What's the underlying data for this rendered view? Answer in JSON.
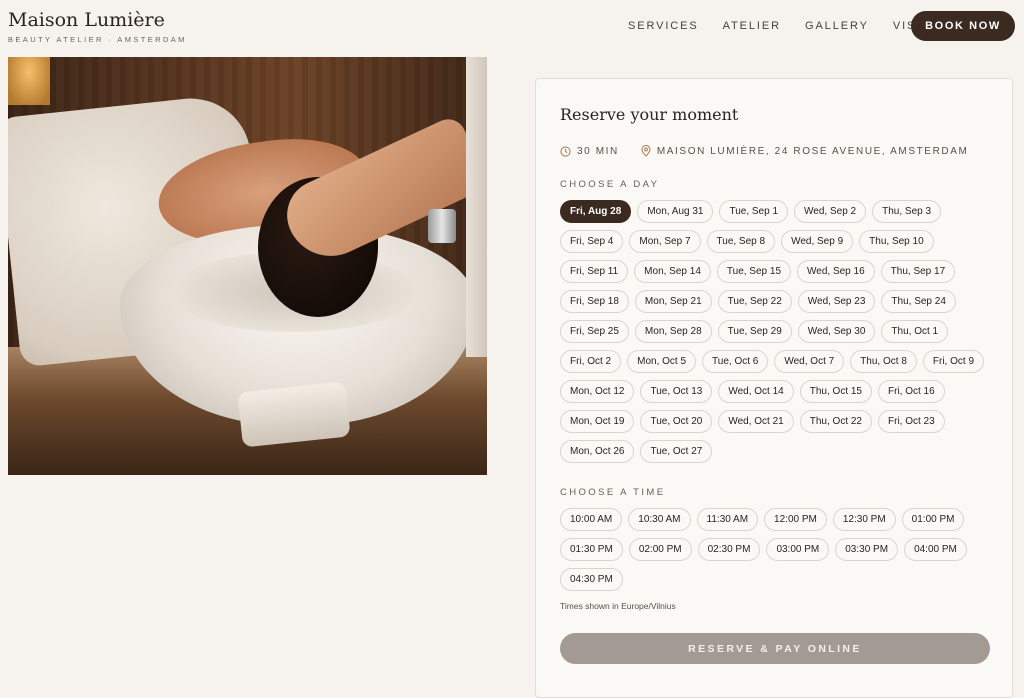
{
  "brand": {
    "name": "Maison Lumière",
    "tagline": "BEAUTY ATELIER · AMSTERDAM"
  },
  "nav": {
    "items": [
      "SERVICES",
      "ATELIER",
      "GALLERY",
      "VISIT"
    ],
    "cta": "BOOK NOW"
  },
  "booking": {
    "title": "Reserve your moment",
    "duration": "30 MIN",
    "location": "MAISON LUMIÈRE, 24 ROSE AVENUE, AMSTERDAM",
    "day_label": "CHOOSE A DAY",
    "days": [
      "Fri, Aug 28",
      "Mon, Aug 31",
      "Tue, Sep 1",
      "Wed, Sep 2",
      "Thu, Sep 3",
      "Fri, Sep 4",
      "Mon, Sep 7",
      "Tue, Sep 8",
      "Wed, Sep 9",
      "Thu, Sep 10",
      "Fri, Sep 11",
      "Mon, Sep 14",
      "Tue, Sep 15",
      "Wed, Sep 16",
      "Thu, Sep 17",
      "Fri, Sep 18",
      "Mon, Sep 21",
      "Tue, Sep 22",
      "Wed, Sep 23",
      "Thu, Sep 24",
      "Fri, Sep 25",
      "Mon, Sep 28",
      "Tue, Sep 29",
      "Wed, Sep 30",
      "Thu, Oct 1",
      "Fri, Oct 2",
      "Mon, Oct 5",
      "Tue, Oct 6",
      "Wed, Oct 7",
      "Thu, Oct 8",
      "Fri, Oct 9",
      "Mon, Oct 12",
      "Tue, Oct 13",
      "Wed, Oct 14",
      "Thu, Oct 15",
      "Fri, Oct 16",
      "Mon, Oct 19",
      "Tue, Oct 20",
      "Wed, Oct 21",
      "Thu, Oct 22",
      "Fri, Oct 23",
      "Mon, Oct 26",
      "Tue, Oct 27"
    ],
    "selected_day": "Fri, Aug 28",
    "time_label": "CHOOSE A TIME",
    "times": [
      "10:00 AM",
      "10:30 AM",
      "11:30 AM",
      "12:00 PM",
      "12:30 PM",
      "01:00 PM",
      "01:30 PM",
      "02:00 PM",
      "02:30 PM",
      "03:00 PM",
      "03:30 PM",
      "04:00 PM",
      "04:30 PM"
    ],
    "timezone": "Times shown in Europe/Vilnius",
    "reserve_label": "RESERVE & PAY ONLINE"
  },
  "colors": {
    "accent": "#3a2a20",
    "disabled_button": "#a39b93",
    "background": "#f6f3ee"
  },
  "icons": {
    "duration": "clock-icon",
    "location": "map-pin-icon"
  }
}
